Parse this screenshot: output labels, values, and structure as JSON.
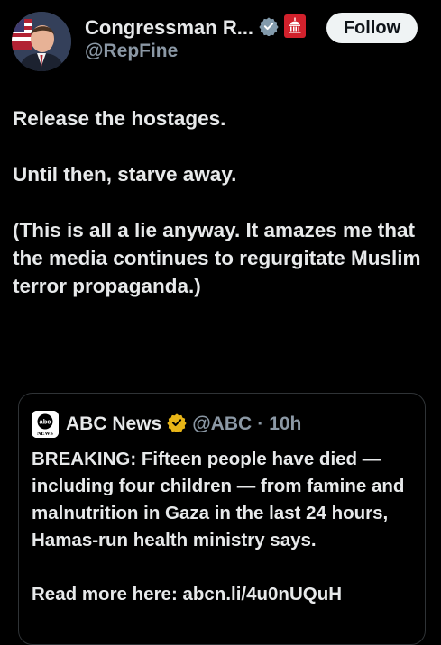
{
  "author": {
    "display_name": "Congressman R...",
    "handle": "@RepFine",
    "verified_icon": "gray-verified-badge-icon",
    "affiliation_icon": "us-congress-seal-icon"
  },
  "follow_button": {
    "label": "Follow"
  },
  "tweet": {
    "paragraphs": [
      "Release the hostages.",
      "Until then, starve away.",
      "(This is all a lie anyway.  It amazes me that the media continues to regurgitate Muslim terror propaganda.)"
    ]
  },
  "quoted_tweet": {
    "author_name": "ABC News",
    "verified_icon": "gold-verified-badge-icon",
    "logo_text": "abc NEWS",
    "handle": "@ABC",
    "separator": "·",
    "time": "10h",
    "text": "BREAKING: Fifteen people have died — including four children — from famine and malnutrition in Gaza in the last 24 hours, Hamas-run health ministry says.",
    "text_cutoff": "Read more here: abcn.li/4u0nUQuH"
  },
  "colors": {
    "background": "#000000",
    "text_primary": "#e7e9ea",
    "text_secondary": "#8b98a5",
    "follow_bg": "#eff3f4",
    "quote_border": "#2f3336",
    "gold_badge": "#e8b517",
    "gray_badge": "#829aab",
    "seal_red": "#d1212c"
  }
}
